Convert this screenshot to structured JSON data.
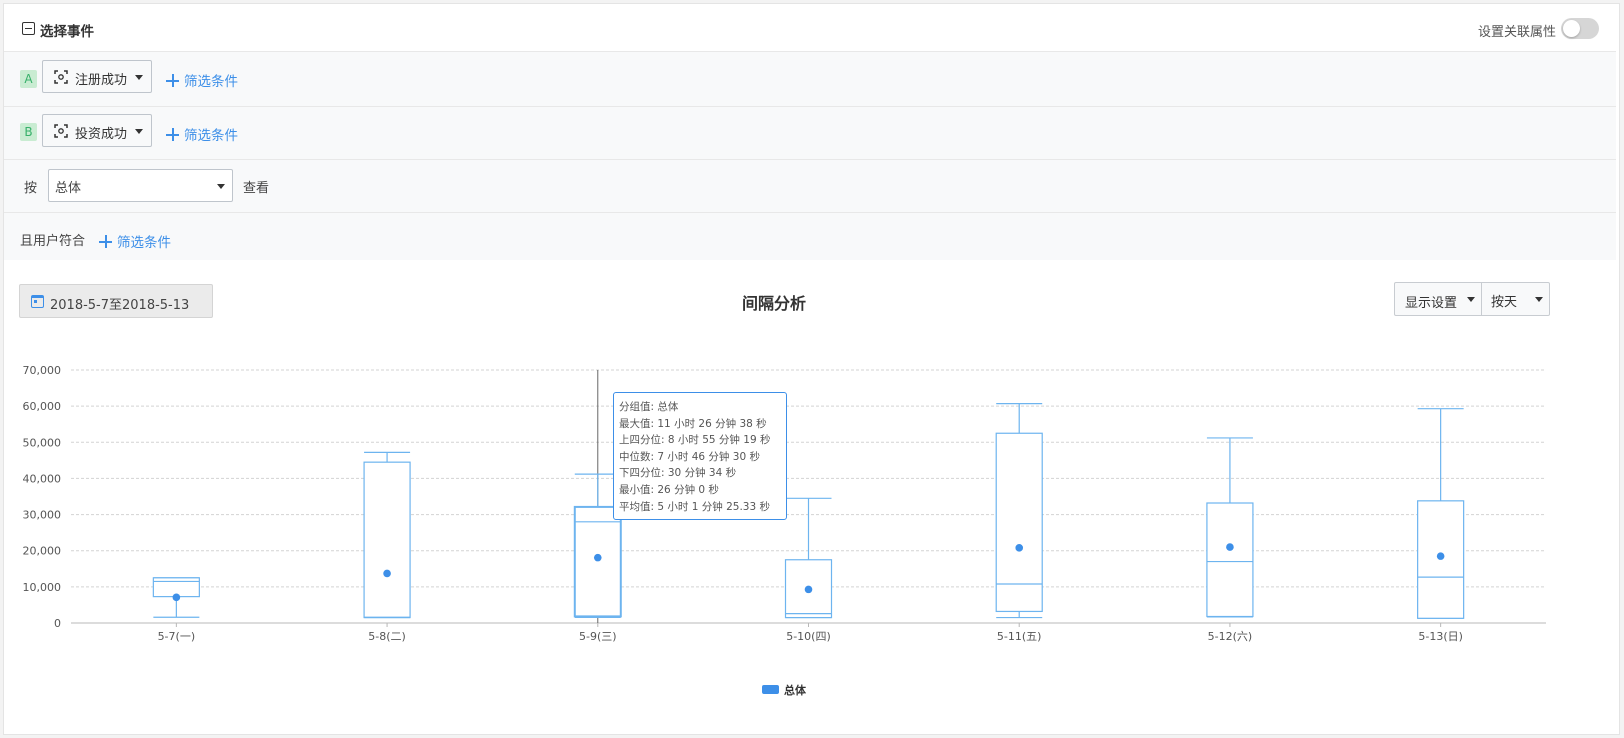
{
  "header": {
    "title": "选择事件",
    "related_label": "设置关联属性"
  },
  "events": [
    {
      "tag": "A",
      "name": "注册成功",
      "add_filter": "筛选条件"
    },
    {
      "tag": "B",
      "name": "投资成功",
      "add_filter": "筛选条件"
    }
  ],
  "group": {
    "prefix": "按",
    "value": "总体",
    "suffix": "查看"
  },
  "user_filter": {
    "label": "且用户符合",
    "add_filter": "筛选条件"
  },
  "toolbar": {
    "date_range": "2018-5-7至2018-5-13",
    "display_settings": "显示设置",
    "granularity": "按天"
  },
  "colors": {
    "accent": "#3d8fe8",
    "box": "#6db4ef"
  },
  "tooltip": {
    "lines": [
      "分组值: 总体",
      "最大值: 11 小时 26 分钟 38 秒",
      "上四分位: 8 小时 55 分钟 19 秒",
      "中位数: 7 小时 46 分钟 30 秒",
      "下四分位: 30 分钟 34 秒",
      "最小值: 26 分钟 0 秒",
      "平均值: 5 小时 1 分钟 25.33 秒"
    ]
  },
  "chart_data": {
    "type": "boxplot",
    "title": "间隔分析",
    "categories": [
      "5-7(一)",
      "5-8(二)",
      "5-9(三)",
      "5-10(四)",
      "5-11(五)",
      "5-12(六)",
      "5-13(日)"
    ],
    "ylim": [
      0,
      70000
    ],
    "yticks": [
      0,
      10000,
      20000,
      30000,
      40000,
      50000,
      60000,
      70000
    ],
    "ytick_labels": [
      "0",
      "10,000",
      "20,000",
      "30,000",
      "40,000",
      "50,000",
      "60,000",
      "70,000"
    ],
    "grid": true,
    "legend": "bottom-center",
    "series": [
      {
        "name": "总体",
        "boxes": [
          {
            "min": 1600,
            "q1": 7300,
            "median": 11500,
            "q3": 12500,
            "max": 12500,
            "mean": 7100
          },
          {
            "min": 1500,
            "q1": 1500,
            "median": 1600,
            "q3": 44500,
            "max": 47200,
            "mean": 13700
          },
          {
            "min": 1560,
            "q1": 1834,
            "median": 27990,
            "q3": 32119,
            "max": 41198,
            "mean": 18085
          },
          {
            "min": 1500,
            "q1": 1500,
            "median": 2600,
            "q3": 17500,
            "max": 34500,
            "mean": 9300
          },
          {
            "min": 1500,
            "q1": 3200,
            "median": 10800,
            "q3": 52500,
            "max": 60700,
            "mean": 20800
          },
          {
            "min": 1700,
            "q1": 1800,
            "median": 17000,
            "q3": 33200,
            "max": 51200,
            "mean": 21000
          },
          {
            "min": 1300,
            "q1": 1300,
            "median": 12700,
            "q3": 33800,
            "max": 59300,
            "mean": 18500
          }
        ]
      }
    ]
  }
}
